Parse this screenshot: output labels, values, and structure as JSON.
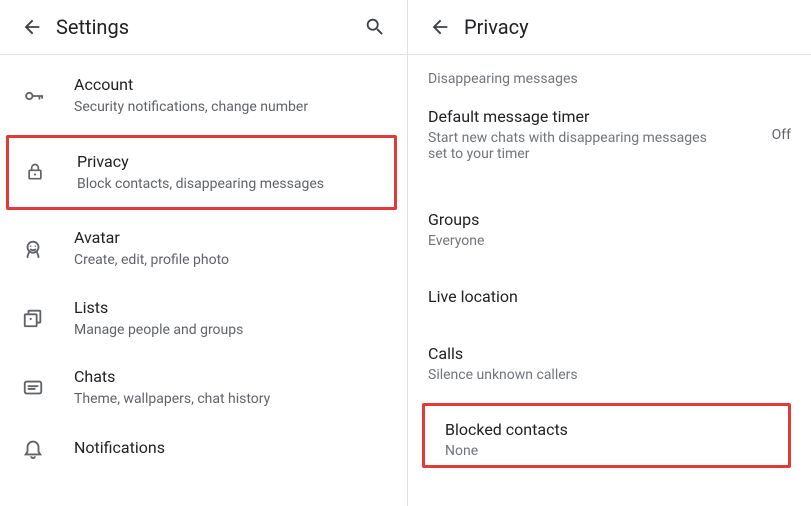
{
  "left": {
    "title": "Settings",
    "search_label": "Search",
    "items": [
      {
        "icon": "key-icon",
        "title": "Account",
        "subtitle": "Security notifications, change number",
        "highlight": false
      },
      {
        "icon": "lock-icon",
        "title": "Privacy",
        "subtitle": "Block contacts, disappearing messages",
        "highlight": true
      },
      {
        "icon": "avatar-icon",
        "title": "Avatar",
        "subtitle": "Create, edit, profile photo",
        "highlight": false
      },
      {
        "icon": "lists-icon",
        "title": "Lists",
        "subtitle": "Manage people and groups",
        "highlight": false
      },
      {
        "icon": "chats-icon",
        "title": "Chats",
        "subtitle": "Theme, wallpapers, chat history",
        "highlight": false
      },
      {
        "icon": "notifications-icon",
        "title": "Notifications",
        "subtitle": "",
        "highlight": false
      }
    ]
  },
  "right": {
    "title": "Privacy",
    "section_label": "Disappearing messages",
    "items": [
      {
        "title": "Default message timer",
        "subtitle": "Start new chats with disappearing messages set to your timer",
        "value": "Off",
        "highlight": false
      },
      {
        "title": "Groups",
        "subtitle": "Everyone",
        "value": "",
        "highlight": false
      },
      {
        "title": "Live location",
        "subtitle": "",
        "value": "",
        "highlight": false
      },
      {
        "title": "Calls",
        "subtitle": "Silence unknown callers",
        "value": "",
        "highlight": false
      },
      {
        "title": "Blocked contacts",
        "subtitle": "None",
        "value": "",
        "highlight": true
      }
    ]
  }
}
